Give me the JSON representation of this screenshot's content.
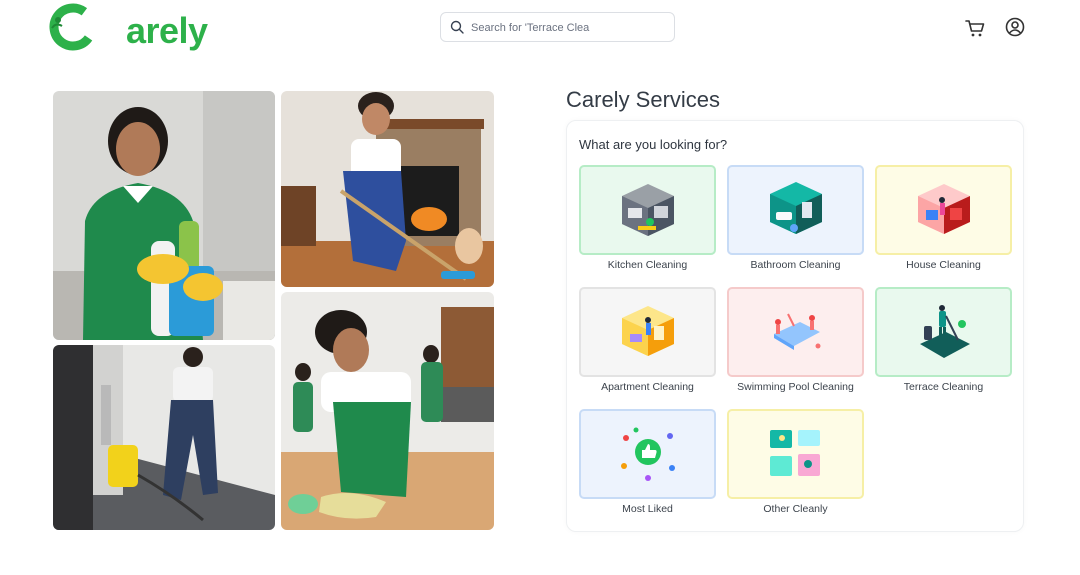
{
  "header": {
    "logo_text": "arely",
    "search": {
      "placeholder": "Search for 'Terrace Clea"
    },
    "cart_icon": "cart-icon",
    "profile_icon": "user-circle-icon"
  },
  "services": {
    "title": "Carely Services",
    "question": "What are you looking for?",
    "items": [
      {
        "label": "Kitchen Cleaning",
        "tile": "green"
      },
      {
        "label": "Bathroom Cleaning",
        "tile": "blue"
      },
      {
        "label": "House Cleaning",
        "tile": "yellow"
      },
      {
        "label": "Apartment Cleaning",
        "tile": "gray"
      },
      {
        "label": "Swimming Pool Cleaning",
        "tile": "pink"
      },
      {
        "label": "Terrace Cleaning",
        "tile": "green"
      },
      {
        "label": "Most Liked",
        "tile": "blue"
      },
      {
        "label": "Other Cleanly",
        "tile": "yellow"
      }
    ]
  },
  "colors": {
    "brand_green": "#2db14a",
    "text_dark": "#343c46"
  }
}
